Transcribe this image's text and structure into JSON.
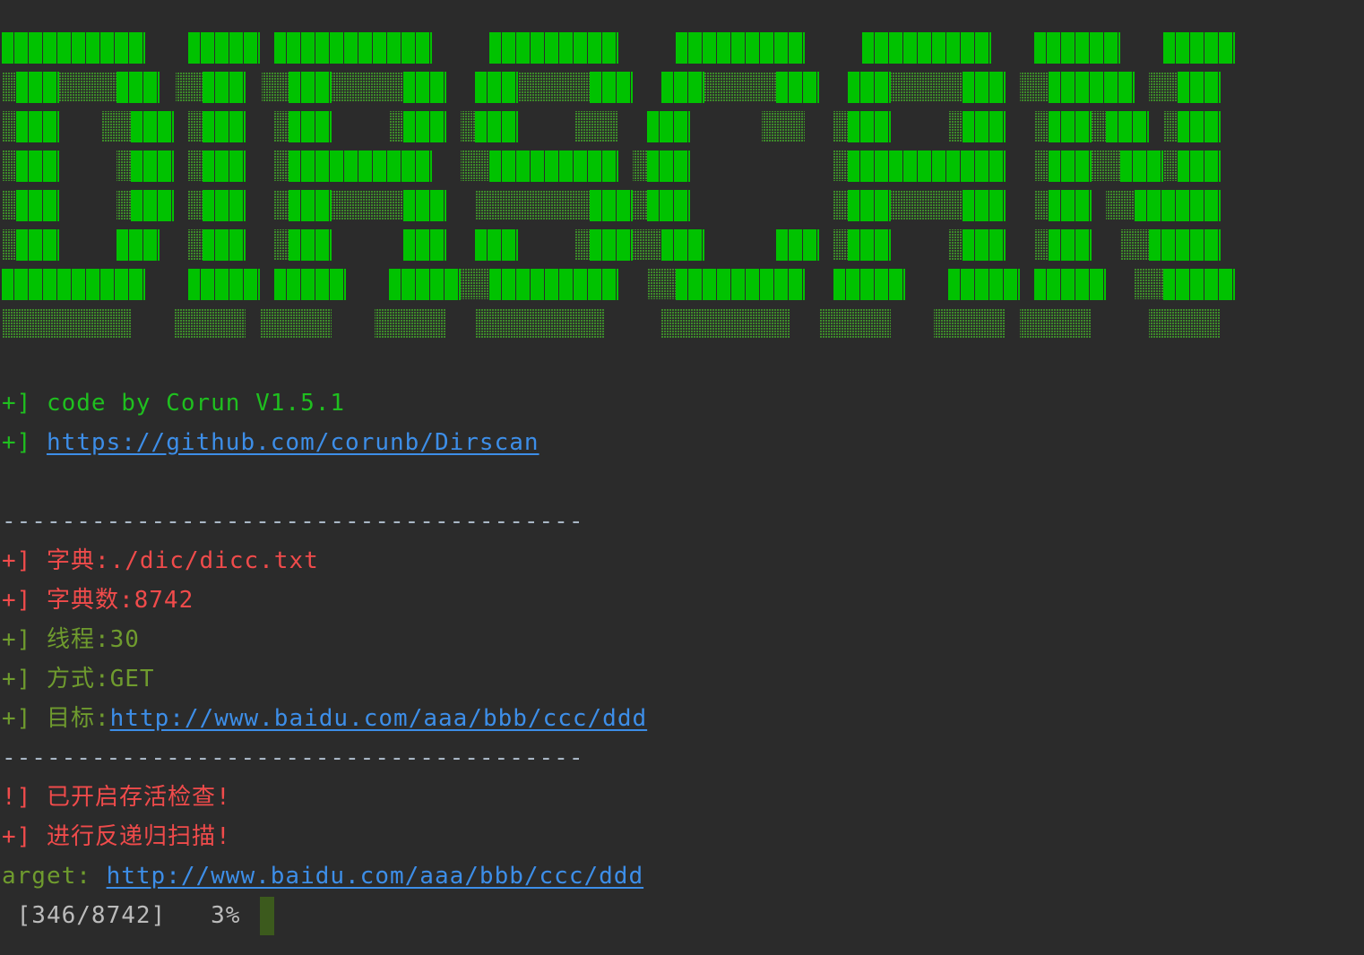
{
  "colors": {
    "background": "#2b2b2b",
    "banner_fill": "#00c200",
    "banner_shade": "#3d8a2a",
    "green": "#1fbf1f",
    "olive": "#6f9b2e",
    "red": "#f04b4b",
    "link": "#3d8ee8",
    "separator": "#a9b7c6"
  },
  "info": {
    "credit": "+] code by Corun V1.5.1",
    "repo_prefix": "+] ",
    "repo_url": "https://github.com/corunb/Dirscan"
  },
  "separator": "---------------------------------------",
  "config": {
    "dict": "+] 字典:./dic/dicc.txt",
    "dict_count": "+] 字典数:8742",
    "threads": "+] 线程:30",
    "method": "+] 方式:GET",
    "target_prefix": "+] 目标:",
    "target_url": "http://www.baidu.com/aaa/bbb/ccc/ddd"
  },
  "status": {
    "alive_check": "!] 已开启存活检查!",
    "recursive": "+] 进行反递归扫描!"
  },
  "scan": {
    "target_label": "arget: ",
    "target_url": "http://www.baidu.com/aaa/bbb/ccc/ddd",
    "counter": " [346/8742]   3%",
    "progress_fraction": 0.04
  }
}
